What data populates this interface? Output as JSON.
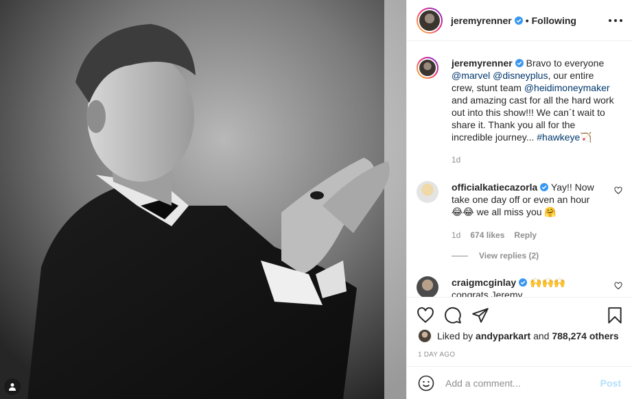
{
  "post": {
    "author": "jeremyrenner",
    "following_label": "Following",
    "caption_segments": [
      {
        "text": "Bravo to everyone ",
        "mention": false
      },
      {
        "text": "@marvel",
        "mention": true
      },
      {
        "text": " ",
        "mention": false
      },
      {
        "text": "@disneyplus",
        "mention": true
      },
      {
        "text": ", our entire crew, stunt team ",
        "mention": false
      },
      {
        "text": "@heidimoneymaker",
        "mention": true
      },
      {
        "text": " and amazing cast for all the hard work out into this show!!! We can´t wait to share it. Thank you all for the incredible journey... ",
        "mention": false
      },
      {
        "text": "#hawkeye",
        "mention": true
      },
      {
        "text": "🏹",
        "mention": false
      }
    ],
    "caption_time": "1d"
  },
  "comments": [
    {
      "username": "officialkatiecazorla",
      "text_lines": [
        "Yay!! Now take one day off or even an hour",
        "😂😂 we all miss you 🤗"
      ],
      "time": "1d",
      "likes": "674 likes",
      "reply_label": "Reply",
      "view_replies": "View replies (2)"
    },
    {
      "username": "craigmcginlay",
      "text": "🙌🙌🙌",
      "text_partial": "congrats Jeremy"
    }
  ],
  "likes_bar": {
    "prefix": "Liked by",
    "user": "andyparkart",
    "connector": "and",
    "others": "788,274 others"
  },
  "time_ago": "1 DAY AGO",
  "comment_box": {
    "placeholder": "Add a comment...",
    "post_label": "Post"
  },
  "colors": {
    "verified": "#3897f0",
    "mention": "#00376b",
    "post_disabled": "#b2dffc"
  }
}
